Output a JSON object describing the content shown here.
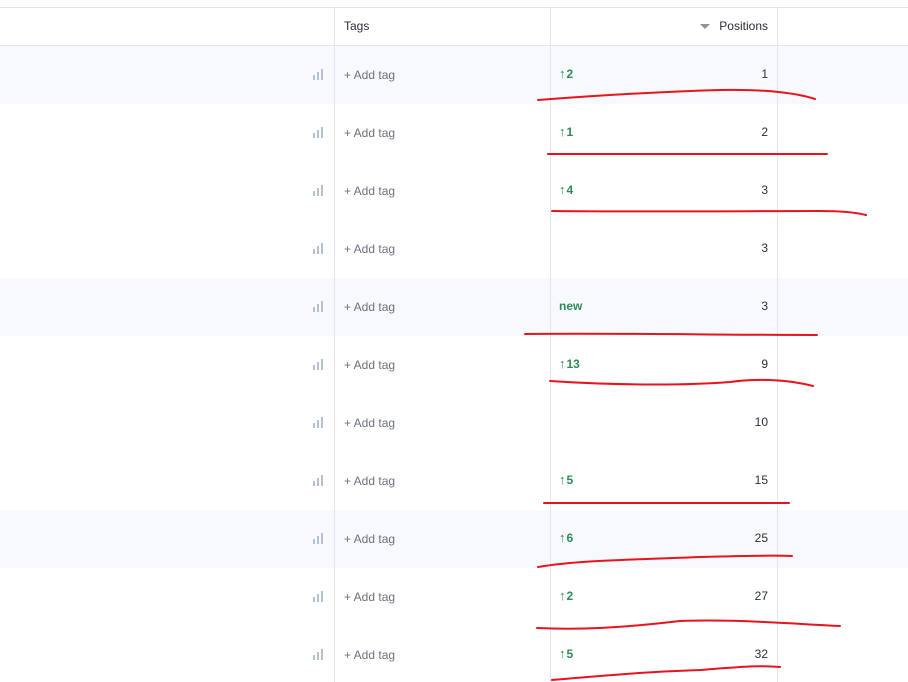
{
  "header": {
    "tags_label": "Tags",
    "positions_label": "Positions",
    "sort_icon": "sort-desc-icon"
  },
  "rows": [
    {
      "add_tag": "+ Add tag",
      "change": "2",
      "position": "1"
    },
    {
      "add_tag": "+ Add tag",
      "change": "1",
      "position": "2"
    },
    {
      "add_tag": "+ Add tag",
      "change": "4",
      "position": "3"
    },
    {
      "add_tag": "+ Add tag",
      "change": "",
      "position": "3"
    },
    {
      "add_tag": "+ Add tag",
      "change": "new",
      "position": "3"
    },
    {
      "add_tag": "+ Add tag",
      "change": "13",
      "position": "9"
    },
    {
      "add_tag": "+ Add tag",
      "change": "",
      "position": "10"
    },
    {
      "add_tag": "+ Add tag",
      "change": "5",
      "position": "15"
    },
    {
      "add_tag": "+ Add tag",
      "change": "6",
      "position": "25"
    },
    {
      "add_tag": "+ Add tag",
      "change": "2",
      "position": "27"
    },
    {
      "add_tag": "+ Add tag",
      "change": "5",
      "position": "32"
    }
  ],
  "colors": {
    "positive_change": "#2e8b57",
    "annotation": "#e8141c",
    "row_shade": "#f7f9fd"
  }
}
